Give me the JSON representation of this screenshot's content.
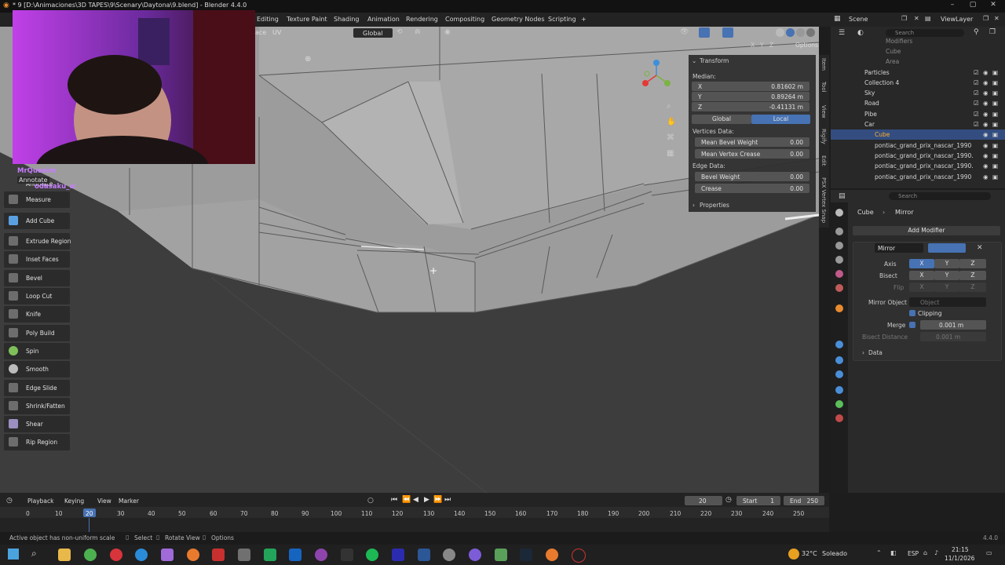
{
  "window": {
    "title": "* 9 [D:\\Animaciones\\3D TAPES\\9\\Scenary\\Daytona\\9.blend] - Blender 4.4.0"
  },
  "menu": [
    "Editing",
    "Texture Paint",
    "Shading",
    "Animation",
    "Rendering",
    "Compositing",
    "Geometry Nodes",
    "Scripting",
    "+"
  ],
  "topright": {
    "scene": "Scene",
    "view_layer": "ViewLayer"
  },
  "viewport_header": {
    "partial_left": "ace",
    "uv": "UV",
    "orientation": "Global",
    "options": "Options",
    "axes": [
      "X",
      "Y",
      "Z"
    ]
  },
  "webcam_overlay": {
    "name1": "MrQueeim",
    "name2": "odasaku_u:"
  },
  "tools": [
    "Annotate",
    "Measure",
    "Add Cube",
    "Extrude Region",
    "Inset Faces",
    "Bevel",
    "Loop Cut",
    "Knife",
    "Poly Build",
    "Spin",
    "Smooth",
    "Edge Slide",
    "Shrink/Fatten",
    "Shear",
    "Rip Region"
  ],
  "npanel": {
    "transform": "Transform",
    "median": "Median:",
    "x_label": "X",
    "x_val": "0.81602 m",
    "y_label": "Y",
    "y_val": "0.89264 m",
    "z_label": "Z",
    "z_val": "-0.41131 m",
    "global": "Global",
    "local": "Local",
    "vertices_data": "Vertices Data:",
    "mean_bevel": "Mean Bevel Weight",
    "mean_bevel_val": "0.00",
    "mean_crease": "Mean Vertex Crease",
    "mean_crease_val": "0.00",
    "edge_data": "Edge Data:",
    "bevel_weight": "Bevel Weight",
    "bevel_weight_val": "0.00",
    "crease": "Crease",
    "crease_val": "0.00",
    "properties": "Properties",
    "tabs": [
      "Item",
      "Tool",
      "View",
      "Rigify",
      "Edit",
      "PSX Vertex Snap"
    ]
  },
  "outliner": {
    "search": "Search",
    "rows": [
      "Modifiers",
      "Cube",
      "Area",
      "Particles",
      "Collection 4",
      "Sky",
      "Road",
      "Pibe",
      "Car",
      "Cube",
      "pontiac_grand_prix_nascar_1990",
      "pontiac_grand_prix_nascar_1990.",
      "pontiac_grand_prix_nascar_1990.",
      "pontiac_grand_prix_nascar_1990"
    ]
  },
  "properties": {
    "search": "Search",
    "breadcrumb_obj": "Cube",
    "breadcrumb_mod": "Mirror",
    "add_modifier": "Add Modifier",
    "modifier_name": "Mirror",
    "axis": "Axis",
    "bisect": "Bisect",
    "flip": "Flip",
    "xyz": [
      "X",
      "Y",
      "Z"
    ],
    "mirror_object": "Mirror Object",
    "mirror_object_placeholder": "Object",
    "clipping": "Clipping",
    "merge": "Merge",
    "merge_val": "0.001 m",
    "bisect_distance": "Bisect Distance",
    "bisect_distance_val": "0.001 m",
    "data": "Data"
  },
  "timeline": {
    "playback": "Playback",
    "keying": "Keying",
    "view": "View",
    "marker": "Marker",
    "current_frame": "20",
    "start_label": "Start",
    "start": "1",
    "end_label": "End",
    "end": "250",
    "ticks": [
      "0",
      "10",
      "20",
      "30",
      "40",
      "50",
      "60",
      "70",
      "80",
      "90",
      "100",
      "110",
      "120",
      "130",
      "140",
      "150",
      "160",
      "170",
      "180",
      "190",
      "200",
      "210",
      "220",
      "230",
      "240",
      "250"
    ]
  },
  "status": {
    "warning": "Active object has non-uniform scale",
    "select": "Select",
    "rotate": "Rotate View",
    "options": "Options",
    "version": "4.4.0"
  },
  "taskbar": {
    "temp": "32°C",
    "weather": "Soleado",
    "lang": "ESP",
    "time": "21:15",
    "date": "11/1/2026"
  }
}
